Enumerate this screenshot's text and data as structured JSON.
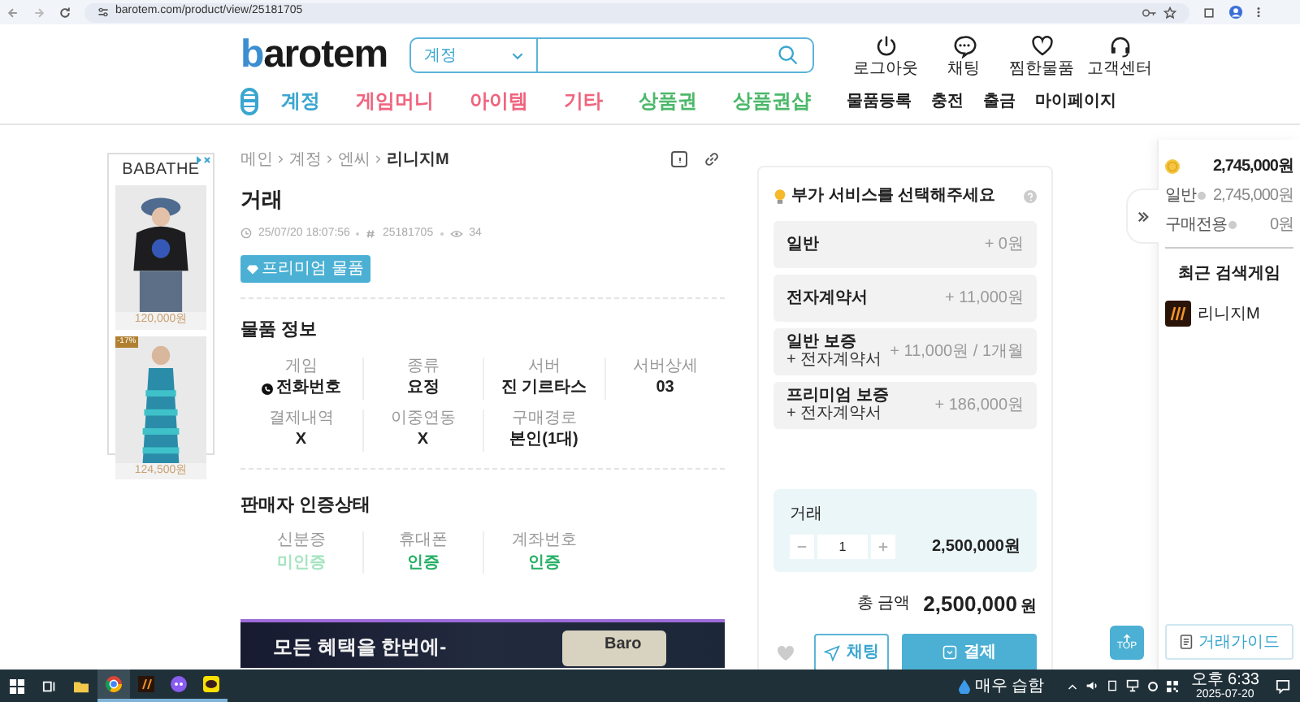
{
  "browser": {
    "url": "barotem.com/product/view/25181705"
  },
  "header": {
    "logo": "barotem",
    "search": {
      "category": "계정"
    },
    "actions": [
      {
        "kind": "power",
        "label": "로그아웃"
      },
      {
        "kind": "chat",
        "label": "채팅"
      },
      {
        "kind": "heart",
        "label": "찜한물품"
      },
      {
        "kind": "headset",
        "label": "고객센터"
      }
    ],
    "nav": [
      {
        "label": "계정",
        "color": "#3aa6d0"
      },
      {
        "label": "게임머니",
        "color": "#f0647e"
      },
      {
        "label": "아이템",
        "color": "#f0647e"
      },
      {
        "label": "기타",
        "color": "#f0647e"
      },
      {
        "label": "상품권",
        "color": "#4cb86a"
      },
      {
        "label": "상품권샵",
        "color": "#4cb86a"
      }
    ],
    "nav_right": [
      "물품등록",
      "충전",
      "출금",
      "마이페이지"
    ]
  },
  "ad": {
    "brand": "BABATHE",
    "products": [
      {
        "price": "120,000원"
      },
      {
        "badge": "-17%",
        "price": "124,500원"
      }
    ]
  },
  "product": {
    "breadcrumb": [
      "메인",
      "계정",
      "엔씨",
      "리니지M"
    ],
    "title": "거래",
    "date": "25/07/20 18:07:56",
    "number": "25181705",
    "views": "34",
    "badge": "프리미엄 물품",
    "info_title": "물품 정보",
    "info": [
      {
        "label": "게임",
        "value": "전화번호",
        "phone": true
      },
      {
        "label": "종류",
        "value": "요정"
      },
      {
        "label": "서버",
        "value": "진 기르타스"
      },
      {
        "label": "서버상세",
        "value": "03"
      },
      {
        "label": "결제내역",
        "value": "X"
      },
      {
        "label": "이중연동",
        "value": "X"
      },
      {
        "label": "구매경로",
        "value": "본인(1대)"
      }
    ],
    "verification_title": "판매자 인증상태",
    "verification": [
      {
        "label": "신분증",
        "value": "미인증",
        "verified": false
      },
      {
        "label": "휴대폰",
        "value": "인증",
        "verified": true
      },
      {
        "label": "계좌번호",
        "value": "인증",
        "verified": true
      }
    ]
  },
  "banner": {
    "text": "모든 혜택을 한번에-",
    "button": "Baro"
  },
  "services": {
    "title": "부가 서비스를 선택해주세요",
    "options": [
      {
        "name": "일반",
        "price": "+ 0원"
      },
      {
        "name": "전자계약서",
        "price": "+ 11,000원"
      },
      {
        "name": "일반 보증",
        "note": "+ 전자계약서",
        "price": "+ 11,000원 / 1개월"
      },
      {
        "name": "프리미엄 보증",
        "note": "+ 전자계약서",
        "price": "+ 186,000원"
      }
    ]
  },
  "order": {
    "label": "거래",
    "quantity": "1",
    "price": "2,500,000원",
    "total_label": "총 금액",
    "total": "2,500,000",
    "unit": "원",
    "chat": "채팅",
    "pay": "결제"
  },
  "sidebar": {
    "balance": "2,745,000원",
    "rows": [
      {
        "label": "일반",
        "value": "2,745,000원"
      },
      {
        "label": "구매전용",
        "value": "0원"
      }
    ],
    "recent_title": "최근 검색게임",
    "recent": [
      {
        "name": "리니지M"
      }
    ],
    "guide": "거래가이드",
    "top": "TOP"
  },
  "taskbar": {
    "weather": "매우 습함",
    "time": "오후 6:33",
    "date": "2025-07-20"
  }
}
